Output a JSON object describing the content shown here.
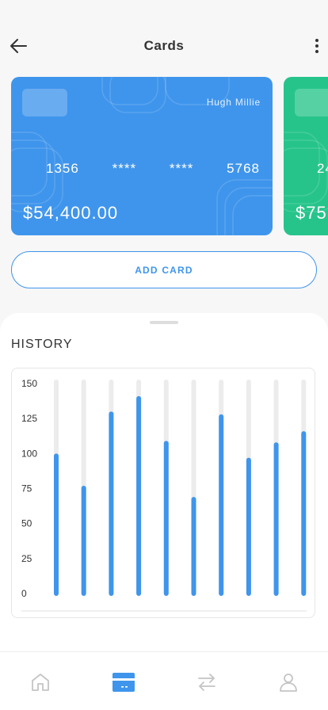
{
  "header": {
    "title": "Cards",
    "back_icon": "arrow-left-icon",
    "more_icon": "more-vertical-icon"
  },
  "cards": [
    {
      "holder": "Hugh Millie",
      "number": [
        "1356",
        "****",
        "****",
        "5768"
      ],
      "balance": "$54,400.00",
      "color": "#3f95ec"
    },
    {
      "holder": "",
      "number": [
        "24",
        "",
        "",
        ""
      ],
      "balance": "$75",
      "color": "#26c48b"
    }
  ],
  "actions": {
    "add_card_label": "ADD CARD"
  },
  "history": {
    "title": "HISTORY",
    "chart_data": {
      "type": "bar",
      "ylim": [
        0,
        150
      ],
      "yticks": [
        0,
        25,
        50,
        75,
        100,
        125,
        150
      ],
      "values": [
        100,
        77,
        130,
        141,
        109,
        69,
        128,
        97,
        108,
        116
      ],
      "bar_color": "#3f95ec",
      "track_color": "#ececec",
      "grid": false
    }
  },
  "nav": {
    "items": [
      {
        "icon": "home-icon",
        "active": false
      },
      {
        "icon": "card-icon",
        "active": true
      },
      {
        "icon": "transfer-icon",
        "active": false
      },
      {
        "icon": "profile-icon",
        "active": false
      }
    ],
    "active_color": "#3f95ec",
    "inactive_color": "#c4c4c4"
  }
}
